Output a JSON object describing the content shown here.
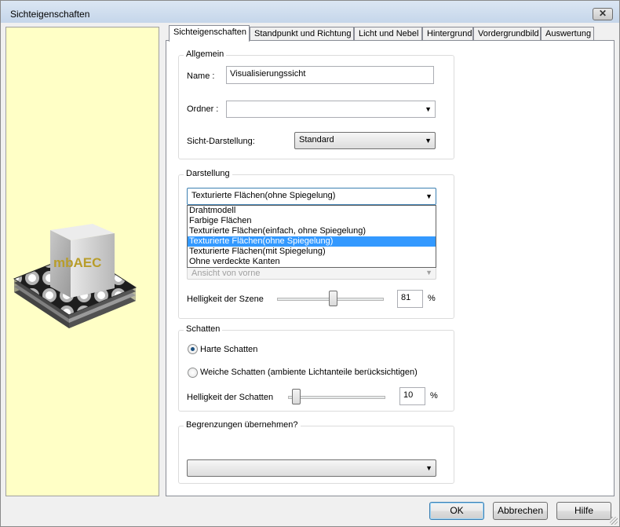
{
  "window": {
    "title": "Sichteigenschaften",
    "close_symbol": "✕"
  },
  "preview": {
    "logo_text": "mbAEC"
  },
  "tabs": [
    {
      "label": "Sichteigenschaften",
      "active": true
    },
    {
      "label": "Standpunkt und Richtung",
      "active": false
    },
    {
      "label": "Licht und Nebel",
      "active": false
    },
    {
      "label": "Hintergrund",
      "active": false
    },
    {
      "label": "Vordergrundbild",
      "active": false
    },
    {
      "label": "Auswertung",
      "active": false
    }
  ],
  "allgemein": {
    "title": "Allgemein",
    "name_label": "Name :",
    "name_value": "Visualisierungssicht",
    "ordner_label": "Ordner :",
    "ordner_value": "",
    "sicht_label": "Sicht-Darstellung:",
    "sicht_value": "Standard"
  },
  "darstellung": {
    "title": "Darstellung",
    "selected": "Texturierte Flächen(ohne Spiegelung)",
    "options": [
      "Drahtmodell",
      "Farbige Flächen",
      "Texturierte Flächen(einfach, ohne Spiegelung)",
      "Texturierte Flächen(ohne Spiegelung)",
      "Texturierte Flächen(mit Spiegelung)",
      "Ohne verdeckte Kanten"
    ],
    "selected_index": 3,
    "ansicht_value": "Ansicht von vorne",
    "helligkeit_label": "Helligkeit der Szene",
    "helligkeit_value": "81",
    "helligkeit_level": 0.52,
    "percent": "%"
  },
  "schatten": {
    "title": "Schatten",
    "harte_label": "Harte Schatten",
    "harte_checked": true,
    "weiche_label": "Weiche Schatten (ambiente Lichtanteile berücksichtigen)",
    "weiche_checked": false,
    "helligkeit_label": "Helligkeit der Schatten",
    "helligkeit_value": "10",
    "helligkeit_level": 0.08,
    "percent": "%"
  },
  "begrenzungen": {
    "title": "Begrenzungen übernehmen?",
    "value": ""
  },
  "buttons": {
    "ok": "OK",
    "cancel": "Abbrechen",
    "help": "Hilfe"
  },
  "colors": {
    "preview_bg": "#ffffc6",
    "selection": "#3399ff"
  }
}
